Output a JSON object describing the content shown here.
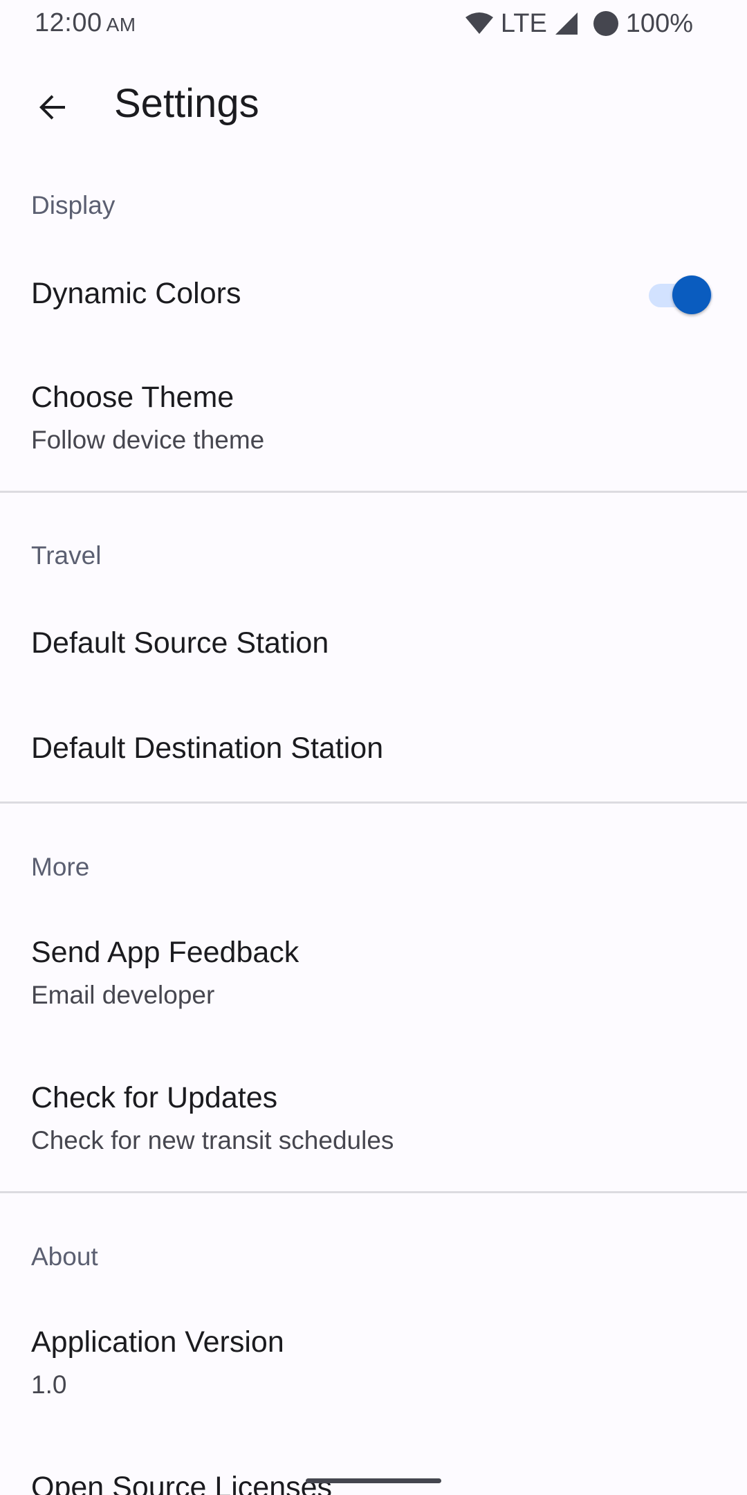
{
  "status_bar": {
    "time": "12:00",
    "ampm": "AM",
    "network": "LTE",
    "battery": "100%",
    "icons": [
      "wifi-icon",
      "signal-icon",
      "battery-icon"
    ]
  },
  "app_bar": {
    "title": "Settings",
    "back_icon": "arrow-back-icon"
  },
  "sections": {
    "display": {
      "header": "Display",
      "dynamic_colors": {
        "title": "Dynamic Colors",
        "enabled": true
      },
      "choose_theme": {
        "title": "Choose Theme",
        "summary": "Follow device theme"
      }
    },
    "travel": {
      "header": "Travel",
      "default_source": {
        "title": "Default Source Station"
      },
      "default_destination": {
        "title": "Default Destination Station"
      }
    },
    "more": {
      "header": "More",
      "send_feedback": {
        "title": "Send App Feedback",
        "summary": "Email developer"
      },
      "check_updates": {
        "title": "Check for Updates",
        "summary": "Check for new transit schedules"
      }
    },
    "about": {
      "header": "About",
      "app_version": {
        "title": "Application Version",
        "summary": "1.0"
      },
      "licenses": {
        "title": "Open Source Licenses"
      }
    }
  },
  "colors": {
    "accent": "#0a5cbf",
    "switch_track": "#d2e2ff",
    "background": "#fdfbff",
    "section_header": "#5b5f71"
  }
}
